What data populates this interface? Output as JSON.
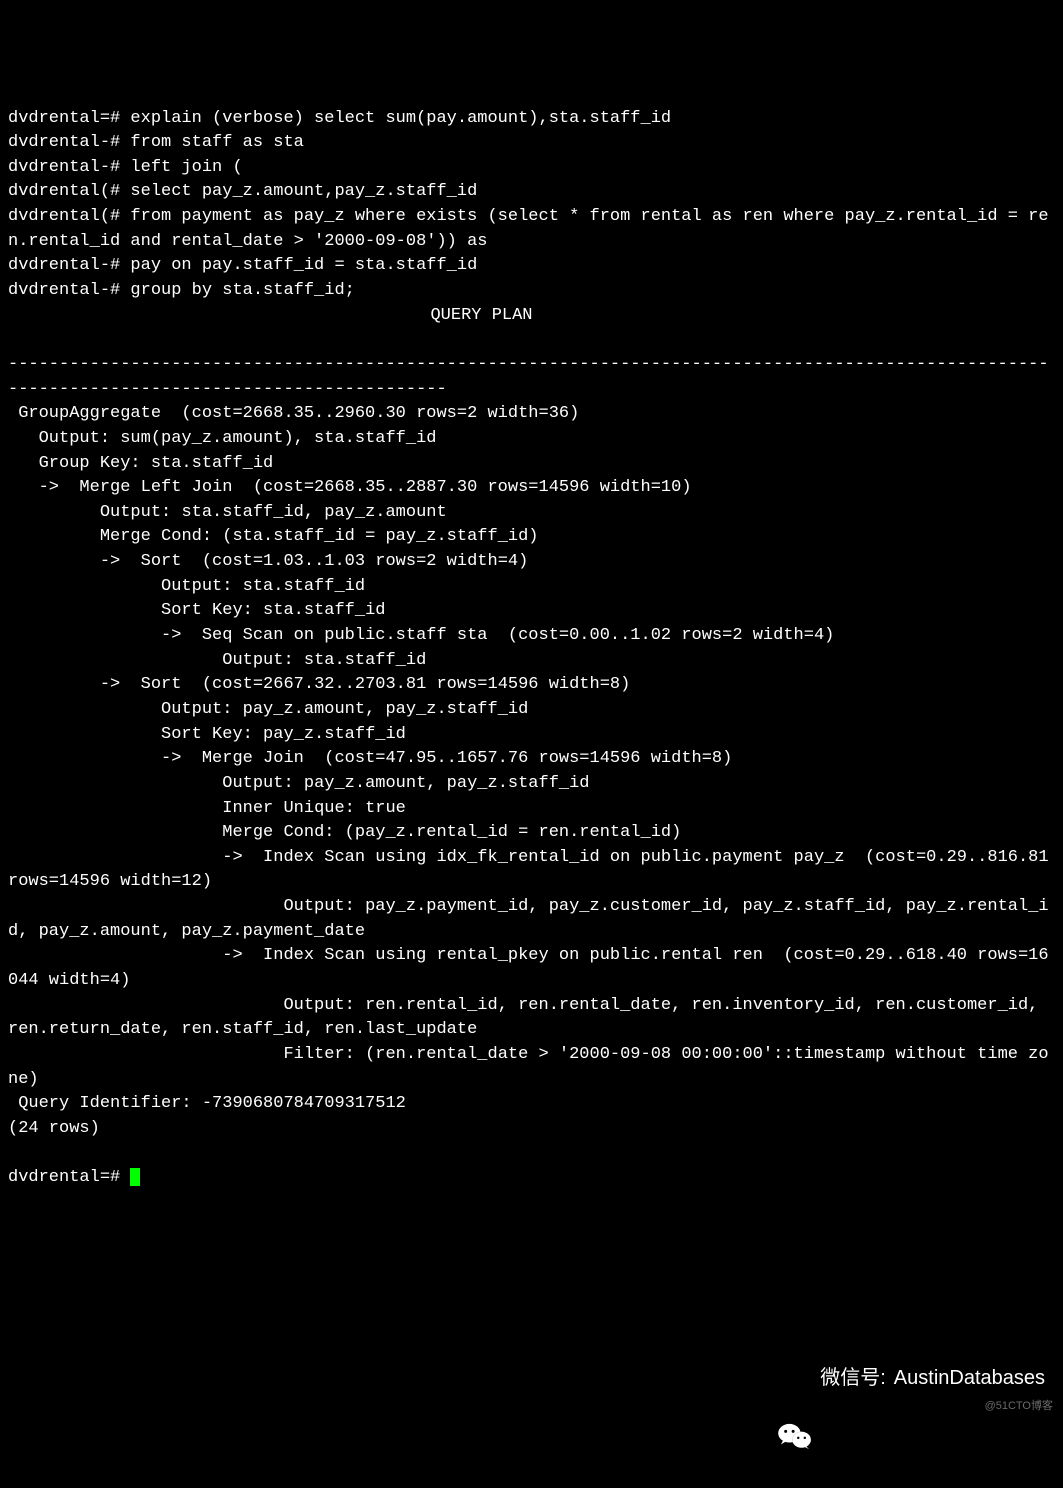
{
  "terminal": {
    "prompt_main": "dvdrental=# ",
    "prompt_cont": "dvdrental-# ",
    "prompt_paren": "dvdrental(# ",
    "query_lines": [
      "explain (verbose) select sum(pay.amount),sta.staff_id",
      "from staff as sta",
      "left join (",
      "select pay_z.amount,pay_z.staff_id",
      "from payment as pay_z where exists (select * from rental as ren where pay_z.rental_id = ren.rental_id and rental_date > '2000-09-08')) as",
      "pay on pay.staff_id = sta.staff_id",
      "group by sta.staff_id;"
    ],
    "header": "QUERY PLAN",
    "separator": "-------------------------------------------------------------------------------------------------------------------------------------------------",
    "plan_lines": [
      " GroupAggregate  (cost=2668.35..2960.30 rows=2 width=36)",
      "   Output: sum(pay_z.amount), sta.staff_id",
      "   Group Key: sta.staff_id",
      "   ->  Merge Left Join  (cost=2668.35..2887.30 rows=14596 width=10)",
      "         Output: sta.staff_id, pay_z.amount",
      "         Merge Cond: (sta.staff_id = pay_z.staff_id)",
      "         ->  Sort  (cost=1.03..1.03 rows=2 width=4)",
      "               Output: sta.staff_id",
      "               Sort Key: sta.staff_id",
      "               ->  Seq Scan on public.staff sta  (cost=0.00..1.02 rows=2 width=4)",
      "                     Output: sta.staff_id",
      "         ->  Sort  (cost=2667.32..2703.81 rows=14596 width=8)",
      "               Output: pay_z.amount, pay_z.staff_id",
      "               Sort Key: pay_z.staff_id",
      "               ->  Merge Join  (cost=47.95..1657.76 rows=14596 width=8)",
      "                     Output: pay_z.amount, pay_z.staff_id",
      "                     Inner Unique: true",
      "                     Merge Cond: (pay_z.rental_id = ren.rental_id)",
      "                     ->  Index Scan using idx_fk_rental_id on public.payment pay_z  (cost=0.29..816.81 rows=14596 width=12)",
      "                           Output: pay_z.payment_id, pay_z.customer_id, pay_z.staff_id, pay_z.rental_id, pay_z.amount, pay_z.payment_date",
      "                     ->  Index Scan using rental_pkey on public.rental ren  (cost=0.29..618.40 rows=16044 width=4)",
      "                           Output: ren.rental_id, ren.rental_date, ren.inventory_id, ren.customer_id, ren.return_date, ren.staff_id, ren.last_update",
      "                           Filter: (ren.rental_date > '2000-09-08 00:00:00'::timestamp without time zone)",
      " Query Identifier: -7390680784709317512",
      "(24 rows)"
    ],
    "final_prompt": "dvdrental=# "
  },
  "watermark": {
    "label": "微信号:",
    "account": "AustinDatabases",
    "small": "@51CTO博客"
  }
}
